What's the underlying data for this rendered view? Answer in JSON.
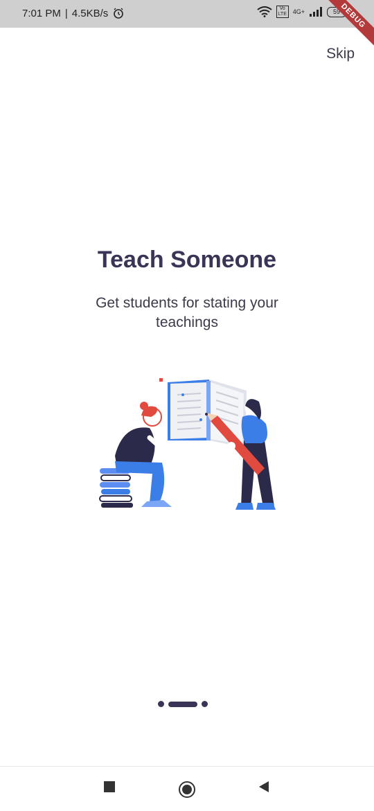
{
  "status_bar": {
    "time": "7:01 PM",
    "net_speed": "4.5KB/s",
    "alarm_icon": "alarm-icon",
    "signal_label": "4G+",
    "volte_label": "Vo LTE",
    "battery_label": "59"
  },
  "debug_banner": "DEBUG",
  "header": {
    "skip_label": "Skip"
  },
  "onboarding": {
    "title": "Teach Someone",
    "subtitle": "Get students for stating your teachings",
    "illustration_icon": "teaching-illustration"
  },
  "page_indicator": {
    "count": 3,
    "active_index": 1
  },
  "nav_bar": {
    "recents_icon": "square-icon",
    "home_icon": "circle-icon",
    "back_icon": "triangle-back-icon"
  },
  "colors": {
    "accent": "#3a3556",
    "blue": "#3b7ee8",
    "red": "#e04a3f"
  }
}
